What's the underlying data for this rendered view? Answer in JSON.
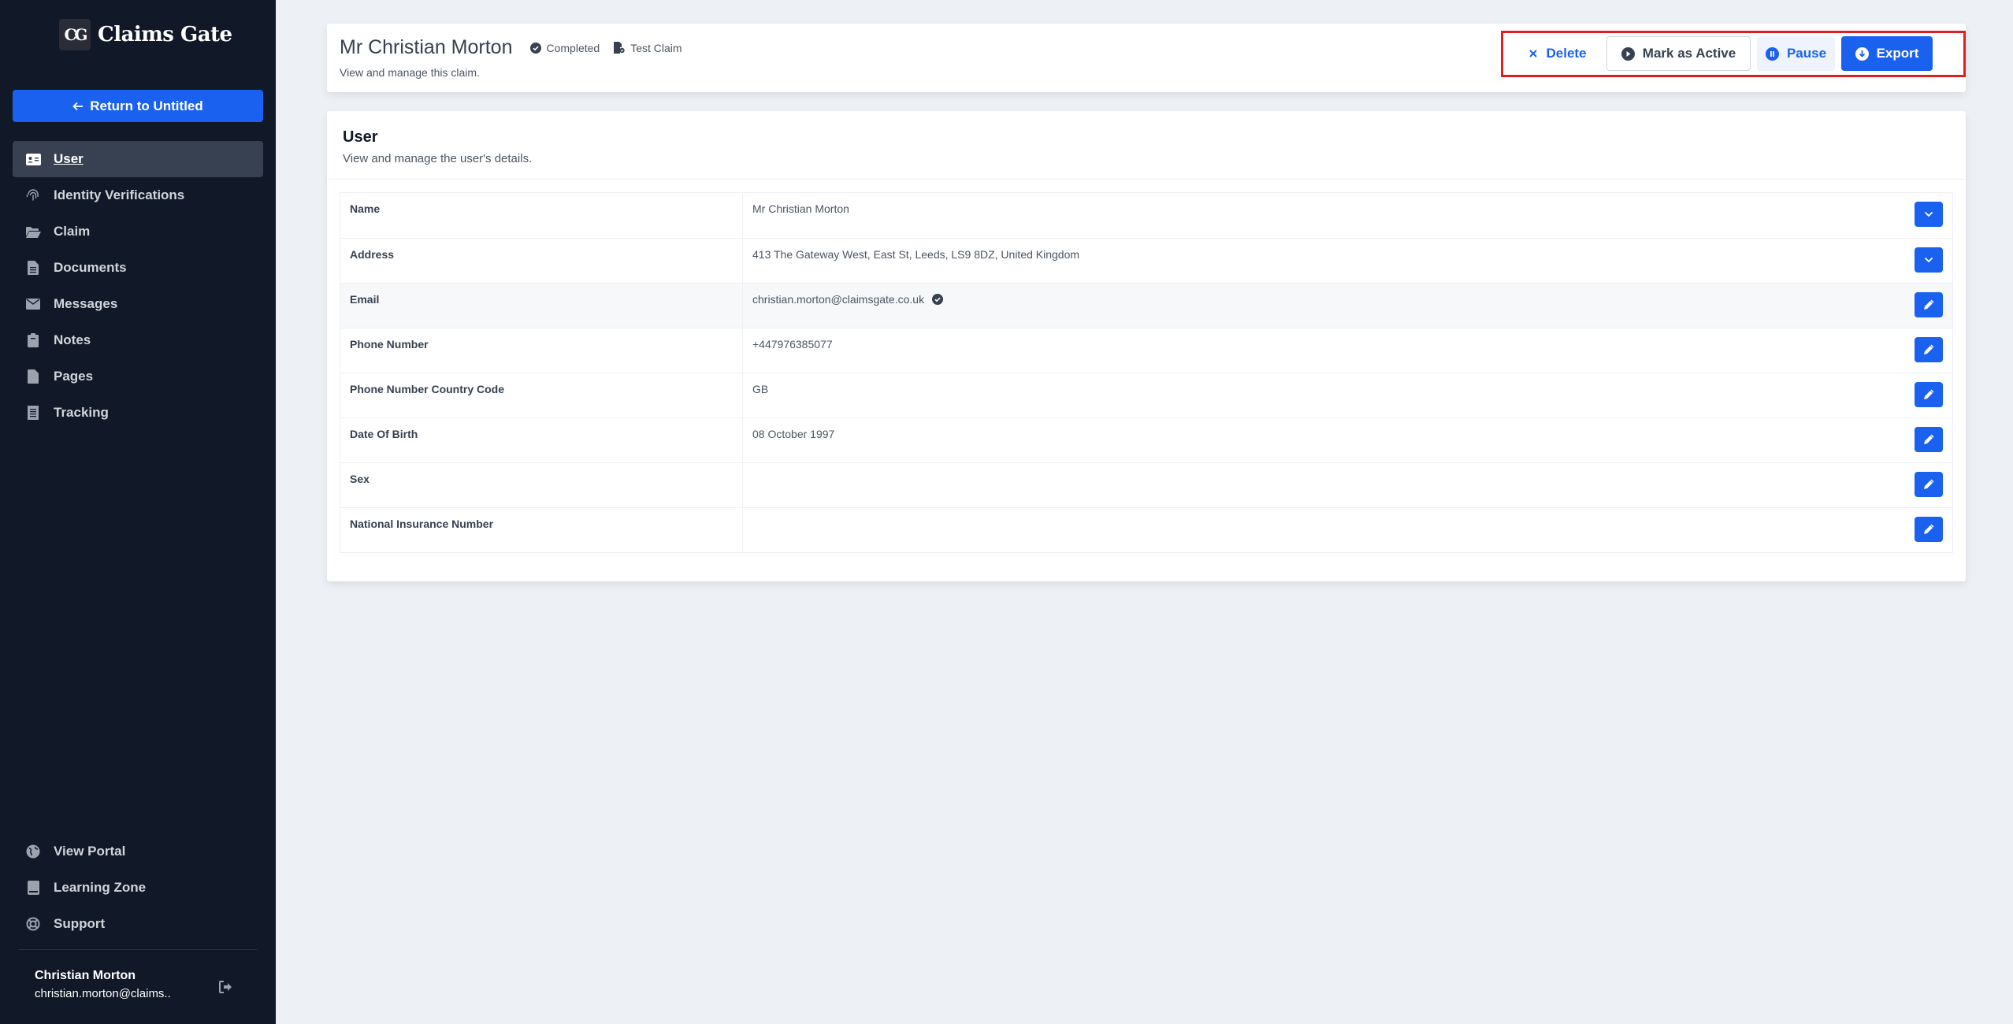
{
  "sidebar": {
    "brand": {
      "logo_text": "CG",
      "name": "Claims Gate"
    },
    "return_button": "Return to Untitled",
    "nav_items": [
      {
        "label": "User",
        "icon": "id-card-icon",
        "active": true
      },
      {
        "label": "Identity Verifications",
        "icon": "fingerprint-icon"
      },
      {
        "label": "Claim",
        "icon": "folder-open-icon"
      },
      {
        "label": "Documents",
        "icon": "document-icon"
      },
      {
        "label": "Messages",
        "icon": "envelope-icon"
      },
      {
        "label": "Notes",
        "icon": "clipboard-icon"
      },
      {
        "label": "Pages",
        "icon": "file-icon"
      },
      {
        "label": "Tracking",
        "icon": "receipt-icon"
      }
    ],
    "bottom_items": [
      {
        "label": "View Portal",
        "icon": "globe-icon"
      },
      {
        "label": "Learning Zone",
        "icon": "book-icon"
      },
      {
        "label": "Support",
        "icon": "lifebuoy-icon"
      }
    ],
    "profile": {
      "name": "Christian Morton",
      "email": "christian.morton@claims.."
    }
  },
  "header": {
    "title": "Mr Christian Morton",
    "status": "Completed",
    "claim_type": "Test Claim",
    "subtitle": "View and manage this claim.",
    "actions": {
      "delete": "Delete",
      "mark_active": "Mark as Active",
      "pause": "Pause",
      "export": "Export"
    }
  },
  "user_card": {
    "title": "User",
    "subtitle": "View and manage the user's details.",
    "rows": [
      {
        "label": "Name",
        "value": "Mr Christian Morton",
        "action": "expand"
      },
      {
        "label": "Address",
        "value": "413 The Gateway West, East St, Leeds, LS9 8DZ, United Kingdom",
        "action": "expand"
      },
      {
        "label": "Email",
        "value": "christian.morton@claimsgate.co.uk",
        "verified": true,
        "action": "edit"
      },
      {
        "label": "Phone Number",
        "value": "+447976385077",
        "action": "edit"
      },
      {
        "label": "Phone Number Country Code",
        "value": "GB",
        "action": "edit"
      },
      {
        "label": "Date Of Birth",
        "value": "08 October 1997",
        "action": "edit"
      },
      {
        "label": "Sex",
        "value": "",
        "action": "edit"
      },
      {
        "label": "National Insurance Number",
        "value": "",
        "action": "edit"
      }
    ]
  },
  "colors": {
    "primary": "#1a61f0",
    "sidebar_bg": "#111827",
    "highlight": "#e11d24"
  }
}
